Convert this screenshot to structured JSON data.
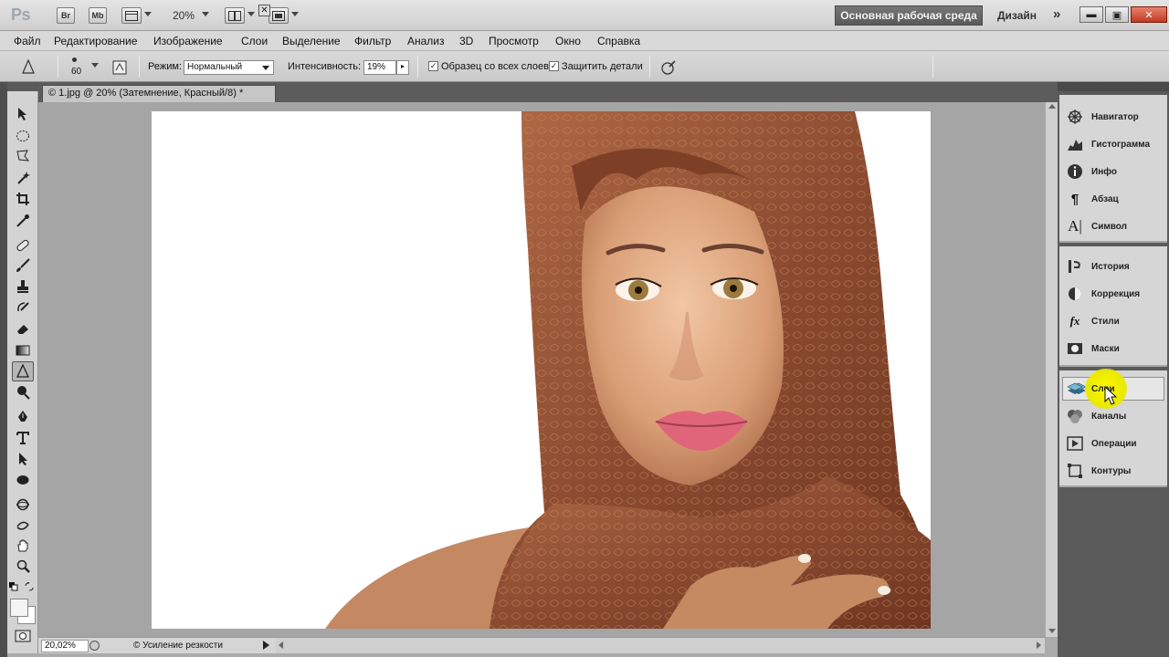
{
  "app": {
    "logo": "Ps",
    "bridge_label": "Br",
    "minibridge_label": "Mb",
    "zoom_level": "20%",
    "workspace_label": "Основная рабочая среда",
    "design_label": "Дизайн",
    "more_label": "»"
  },
  "menu": [
    "Файл",
    "Редактирование",
    "Изображение",
    "Слои",
    "Выделение",
    "Фильтр",
    "Анализ",
    "3D",
    "Просмотр",
    "Окно",
    "Справка"
  ],
  "options": {
    "brush_size": "60",
    "mode_label": "Режим:",
    "mode_value": "Нормальный",
    "intensity_label": "Интенсивность:",
    "intensity_value": "19%",
    "sample_all_label": "Образец со всех слоев",
    "sample_all_checked": true,
    "protect_detail_label": "Защитить детали",
    "protect_detail_checked": true
  },
  "document": {
    "tab_title": "© 1.jpg @ 20% (Затемнение, Красный/8) *",
    "status_zoom": "20,02%",
    "status_text": "© Усиление резкости"
  },
  "panels": {
    "group1": [
      {
        "label": "Навигатор",
        "icon": "navigator-icon"
      },
      {
        "label": "Гистограмма",
        "icon": "histogram-icon"
      },
      {
        "label": "Инфо",
        "icon": "info-icon"
      },
      {
        "label": "Абзац",
        "icon": "paragraph-icon"
      },
      {
        "label": "Символ",
        "icon": "character-icon"
      }
    ],
    "group2": [
      {
        "label": "История",
        "icon": "history-icon"
      },
      {
        "label": "Коррекция",
        "icon": "adjustments-icon"
      },
      {
        "label": "Стили",
        "icon": "styles-icon"
      },
      {
        "label": "Маски",
        "icon": "masks-icon"
      }
    ],
    "group3": [
      {
        "label": "Слои",
        "icon": "layers-icon",
        "active": true
      },
      {
        "label": "Каналы",
        "icon": "channels-icon"
      },
      {
        "label": "Операции",
        "icon": "actions-icon"
      },
      {
        "label": "Контуры",
        "icon": "paths-icon"
      }
    ]
  },
  "colors": {
    "highlight": "#f2ef00",
    "scarf": "#8a4a30",
    "workspace_bg": "#666666"
  }
}
